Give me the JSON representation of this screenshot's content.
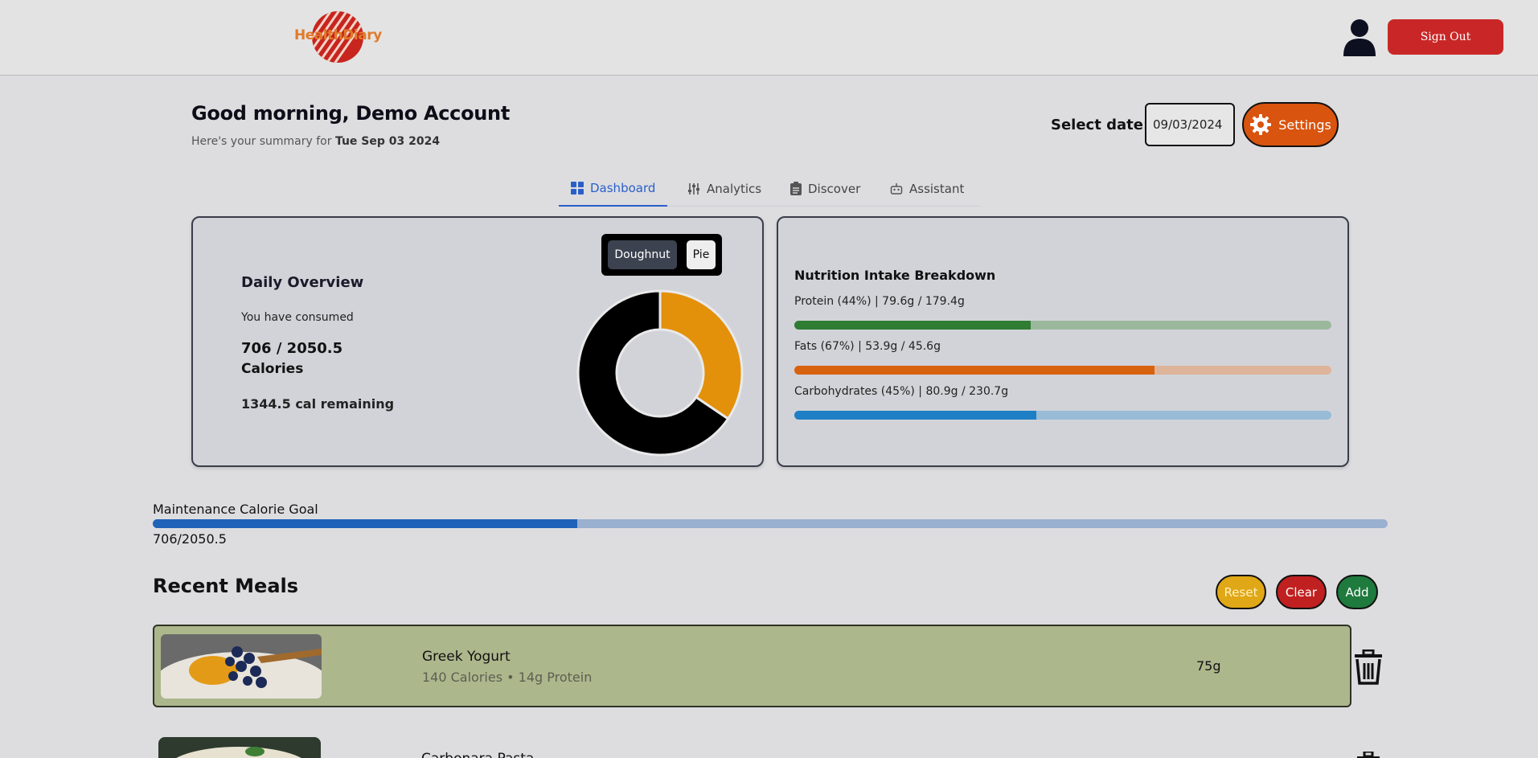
{
  "header": {
    "logo_text": "HealthDiary",
    "sign_out_label": "Sign Out"
  },
  "greeting": {
    "title": "Good morning, Demo Account",
    "summary_prefix": "Here's your summary for ",
    "summary_date": "Tue Sep 03 2024"
  },
  "date_select": {
    "label": "Select date:",
    "value": "09/03/2024",
    "settings_label": "Settings"
  },
  "tabs": [
    {
      "label": "Dashboard",
      "icon": "grid-icon",
      "active": true
    },
    {
      "label": "Analytics",
      "icon": "sliders-icon",
      "active": false
    },
    {
      "label": "Discover",
      "icon": "clipboard-icon",
      "active": false
    },
    {
      "label": "Assistant",
      "icon": "robot-icon",
      "active": false
    }
  ],
  "overview": {
    "title": "Daily Overview",
    "consumed_label": "You have consumed",
    "value": "706 / 2050.5",
    "unit": "Calories",
    "remaining": "1344.5 cal remaining",
    "toggle_doughnut": "Doughnut",
    "toggle_pie": "Pie",
    "chart": {
      "consumed": 706,
      "remaining": 1344.5,
      "colors": [
        "#e3900a",
        "#000000"
      ]
    }
  },
  "nutrition": {
    "title": "Nutrition Intake Breakdown",
    "items": [
      {
        "label": "Protein (44%) | 79.6g / 179.4g",
        "percent": 44,
        "fill": "#2e7d32",
        "track": "#9cb89c"
      },
      {
        "label": "Fats (67%) | 53.9g / 45.6g",
        "percent": 67,
        "fill": "#d9620f",
        "track": "#ddb39a"
      },
      {
        "label": "Carbohydrates (45%) | 80.9g / 230.7g",
        "percent": 45,
        "fill": "#1e7fc4",
        "track": "#98bcd6"
      }
    ]
  },
  "maintenance": {
    "label": "Maintenance Calorie Goal",
    "value": "706/2050.5",
    "fraction": 0.344
  },
  "meals": {
    "title": "Recent Meals",
    "reset_label": "Reset",
    "clear_label": "Clear",
    "add_label": "Add",
    "items": [
      {
        "name": "Greek Yogurt",
        "details": "140 Calories • 14g Protein",
        "qty": "75g"
      },
      {
        "name": "Carbonara Pasta"
      }
    ]
  }
}
